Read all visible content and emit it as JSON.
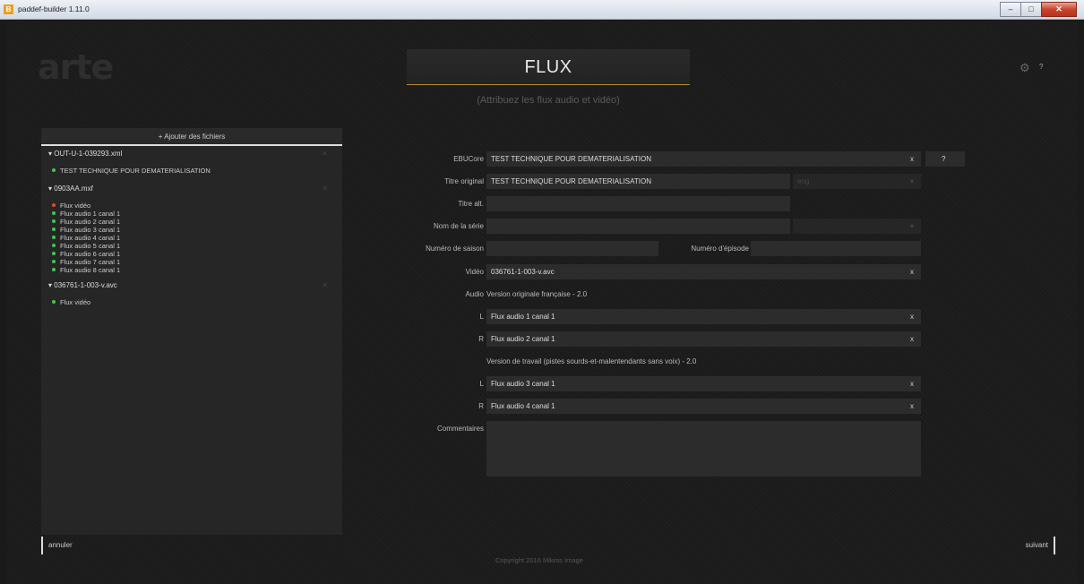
{
  "window": {
    "title": "paddef-builder 1.11.0",
    "app_icon": "B"
  },
  "logo": "arte",
  "header": {
    "title": "FLUX",
    "subtitle": "(Attribuez les flux audio et vidéo)",
    "help": "?"
  },
  "sidebar": {
    "add_files": "+ Ajouter des fichiers",
    "groups": [
      {
        "name": "▾ OUT-U-1-039293.xml",
        "items": [
          {
            "label": "TEST TECHNIQUE POUR DEMATERIALISATION",
            "status": "green"
          }
        ]
      },
      {
        "name": "▾ 0903AA.mxf",
        "items": [
          {
            "label": "Flux vidéo",
            "status": "red"
          },
          {
            "label": "Flux audio 1 canal 1",
            "status": "green"
          },
          {
            "label": "Flux audio 2 canal 1",
            "status": "green"
          },
          {
            "label": "Flux audio 3 canal 1",
            "status": "green"
          },
          {
            "label": "Flux audio 4 canal 1",
            "status": "green"
          },
          {
            "label": "Flux audio 5 canal 1",
            "status": "green"
          },
          {
            "label": "Flux audio 6 canal 1",
            "status": "green"
          },
          {
            "label": "Flux audio 7 canal 1",
            "status": "green"
          },
          {
            "label": "Flux audio 8 canal 1",
            "status": "green"
          }
        ]
      },
      {
        "name": "▾ 036761-1-003-v.avc",
        "items": [
          {
            "label": "Flux vidéo",
            "status": "green"
          }
        ]
      }
    ]
  },
  "form": {
    "ebucore": {
      "label": "EBUCore",
      "value": "TEST TECHNIQUE POUR DEMATERIALISATION",
      "clear": "x",
      "help": "?"
    },
    "titre_original": {
      "label": "Titre original",
      "value": "TEST TECHNIQUE POUR DEMATERIALISATION",
      "lang": "eng"
    },
    "titre_alt": {
      "label": "Titre alt.",
      "value": ""
    },
    "nom_serie": {
      "label": "Nom de la série",
      "value": ""
    },
    "numero_saison": {
      "label": "Numéro de saison",
      "value": ""
    },
    "numero_episode": {
      "label": "Numéro d'épisode",
      "value": ""
    },
    "video": {
      "label": "Vidéo",
      "value": "036761-1-003-v.avc",
      "clear": "x"
    },
    "audio": {
      "label": "Audio",
      "version1": "Version originale française - 2.0",
      "version2": "Version de travail (pistes sourds-et-malentendants sans voix) - 2.0"
    },
    "channels": [
      {
        "label": "L",
        "value": "Flux audio 1 canal 1",
        "clear": "x"
      },
      {
        "label": "R",
        "value": "Flux audio 2 canal 1",
        "clear": "x"
      },
      {
        "label": "L",
        "value": "Flux audio 3 canal 1",
        "clear": "x"
      },
      {
        "label": "R",
        "value": "Flux audio 4 canal 1",
        "clear": "x"
      }
    ],
    "commentaires": {
      "label": "Commentaires",
      "value": ""
    }
  },
  "footer": {
    "cancel": "annuler",
    "next": "suivant",
    "copyright": "Copyright 2016 Mikros Image"
  },
  "colors": {
    "accent": "#b58a3a",
    "status_green": "#3ec94a",
    "status_red": "#e04a2a"
  }
}
